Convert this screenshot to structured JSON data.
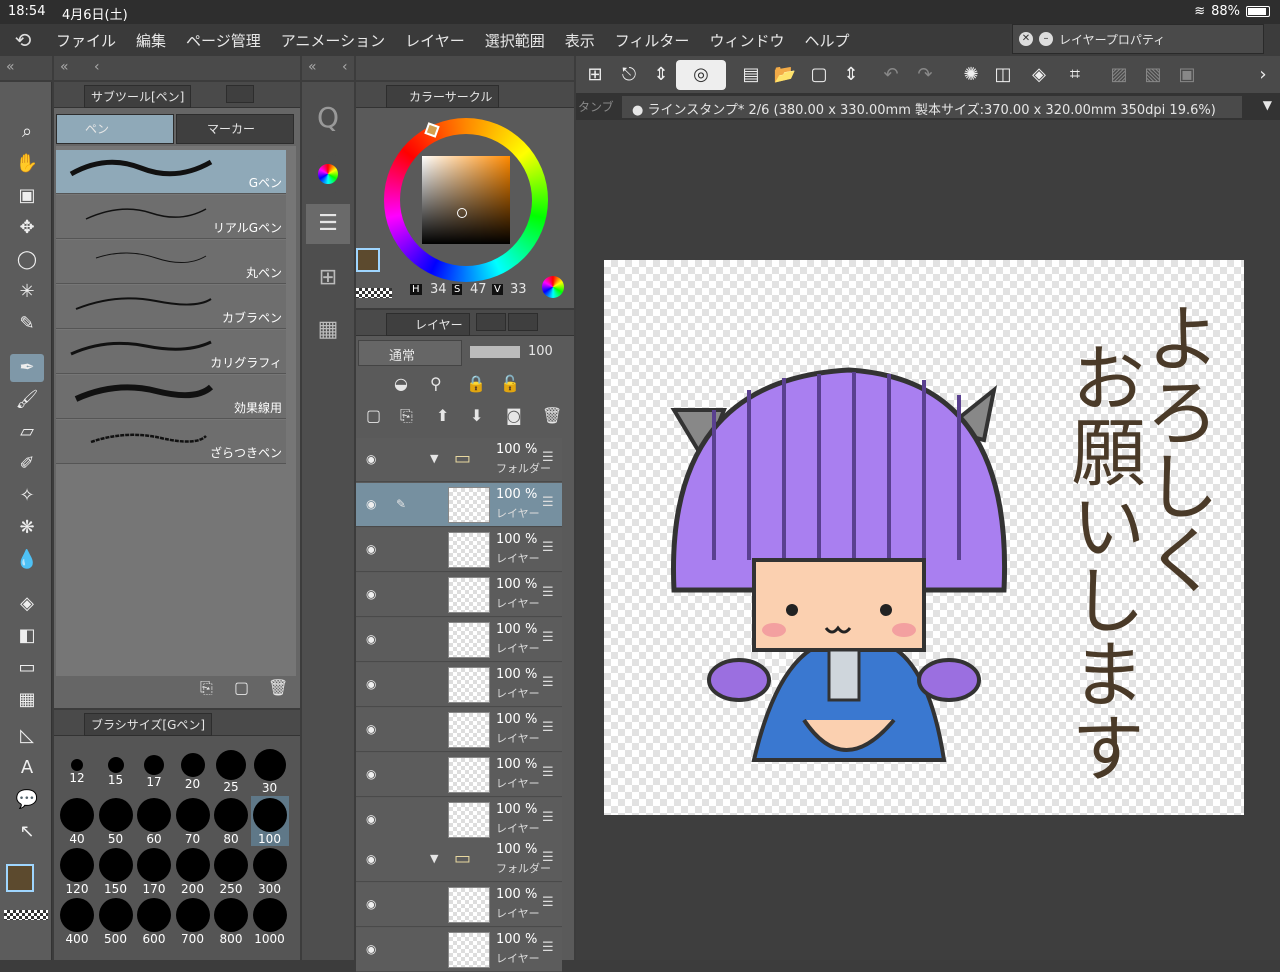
{
  "status": {
    "time": "18:54",
    "date": "4月6日(土)",
    "battery": "88%"
  },
  "menu": [
    "ファイル",
    "編集",
    "ページ管理",
    "アニメーション",
    "レイヤー",
    "選択範囲",
    "表示",
    "フィルター",
    "ウィンドウ",
    "ヘルプ"
  ],
  "layer_property": {
    "title": "レイヤープロパティ"
  },
  "subtool": {
    "header": "サブツール[ペン]",
    "tabs": [
      "ペン",
      "マーカー"
    ],
    "brushes": [
      "Gペン",
      "リアルGペン",
      "丸ペン",
      "カブラペン",
      "カリグラフィ",
      "効果線用",
      "ざらつきペン"
    ]
  },
  "brush_size": {
    "header": "ブラシサイズ[Gペン]",
    "sizes": [
      "12",
      "15",
      "17",
      "20",
      "25",
      "30",
      "40",
      "50",
      "60",
      "70",
      "80",
      "100",
      "120",
      "150",
      "170",
      "200",
      "250",
      "300",
      "400",
      "500",
      "600",
      "700",
      "800",
      "1000"
    ],
    "selected": "100"
  },
  "color_circle": {
    "header": "カラーサークル",
    "h_label": "H",
    "h": "34",
    "s_label": "S",
    "s": "47",
    "v_label": "V",
    "v": "33",
    "main_color": "#5c4a2e"
  },
  "layer": {
    "header": "レイヤー",
    "blend_mode": "通常",
    "opacity": "100",
    "rows": [
      {
        "pct": "100 %",
        "name": "フォルダー"
      },
      {
        "pct": "100 %",
        "name": "レイヤー"
      },
      {
        "pct": "100 %",
        "name": "レイヤー"
      },
      {
        "pct": "100 %",
        "name": "レイヤー"
      },
      {
        "pct": "100 %",
        "name": "レイヤー"
      },
      {
        "pct": "100 %",
        "name": "レイヤー"
      },
      {
        "pct": "100 %",
        "name": "レイヤー"
      },
      {
        "pct": "100 %",
        "name": "レイヤー"
      },
      {
        "pct": "100 %",
        "name": "レイヤー"
      },
      {
        "pct": "100 %",
        "name": "フォルダー"
      },
      {
        "pct": "100 %",
        "name": "レイヤー"
      },
      {
        "pct": "100 %",
        "name": "レイヤー"
      }
    ]
  },
  "document": {
    "tab_left": "タンブ",
    "title": "ラインスタンプ* 2/6 (380.00 x 330.00mm 製本サイズ:370.00 x 320.00mm 350dpi 19.6%)"
  },
  "artwork": {
    "line1": "よろしく",
    "line2": "お願いします"
  }
}
